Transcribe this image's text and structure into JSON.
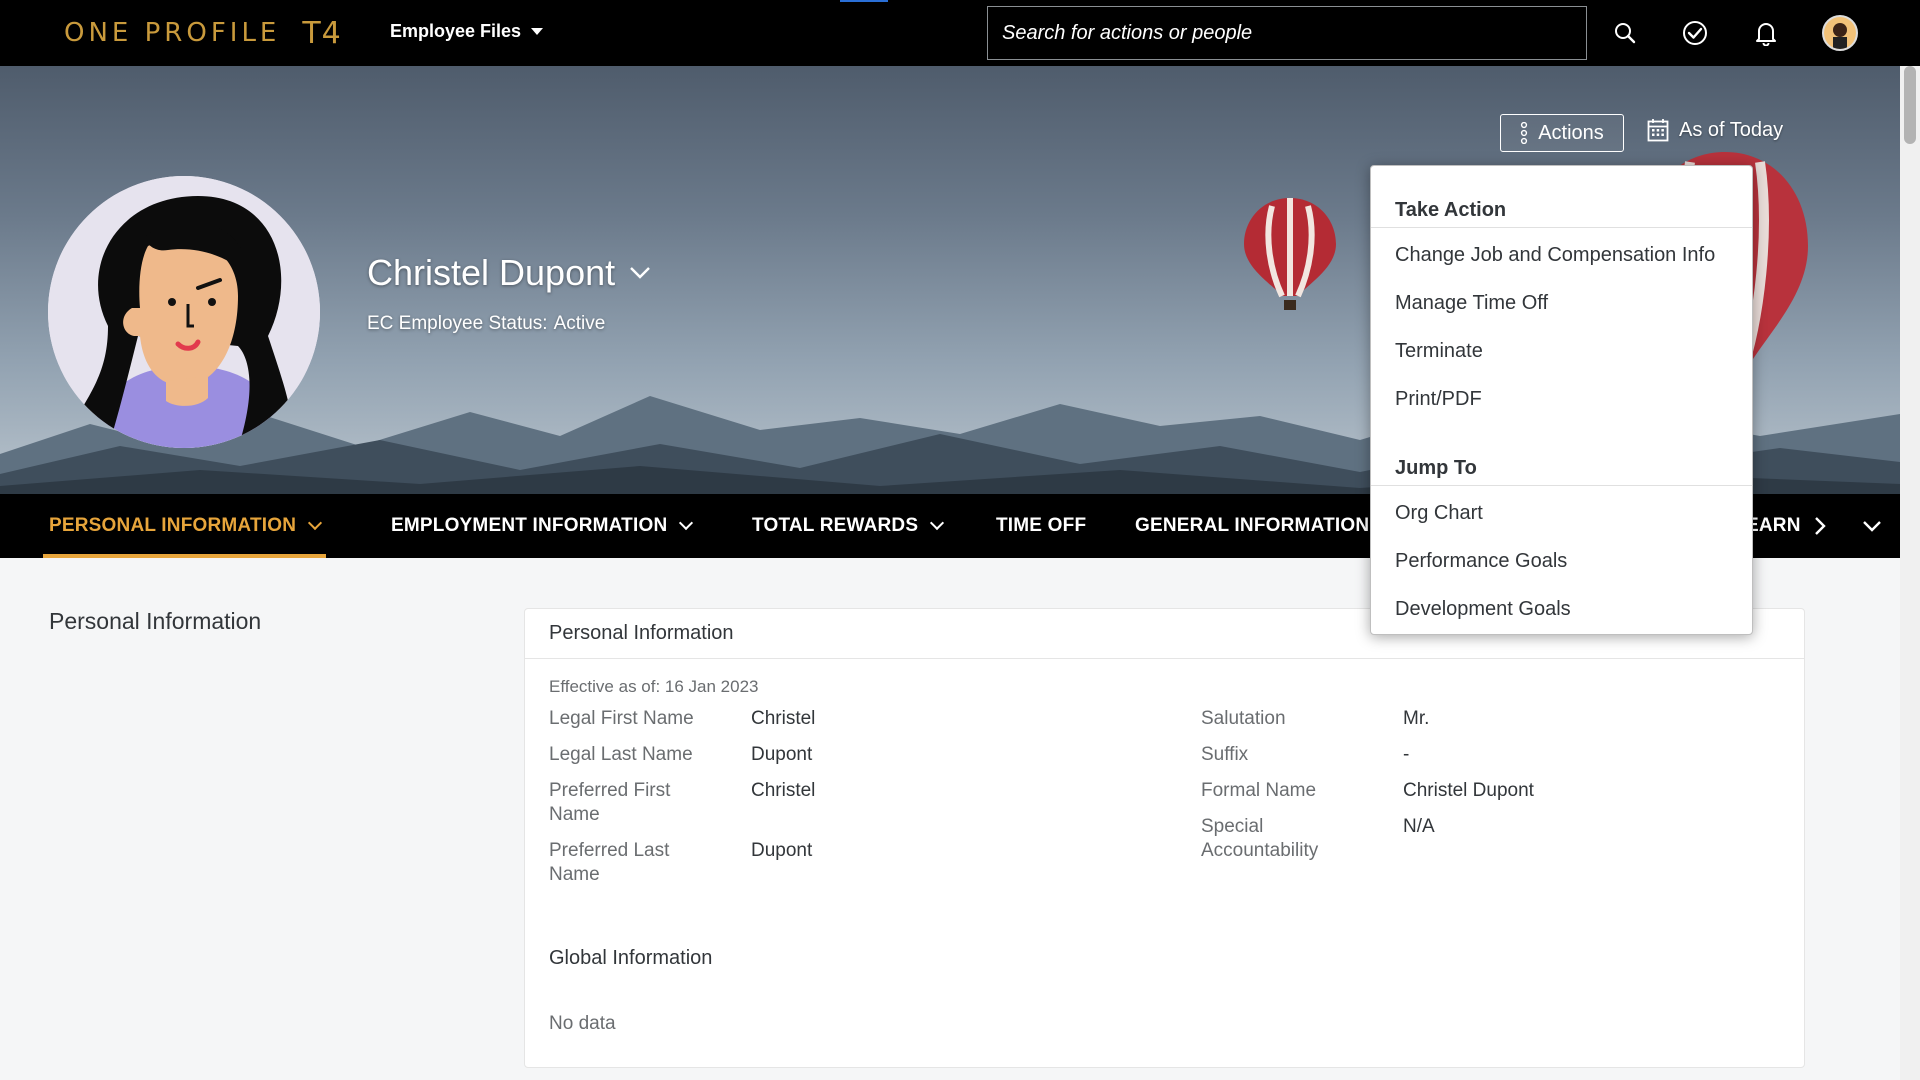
{
  "shell": {
    "logo_text": "ONE PROFILE",
    "logo_suffix": "T4",
    "module_label": "Employee Files",
    "search_placeholder": "Search for actions or people",
    "icons": [
      "search-icon",
      "task-check-icon",
      "bell-icon",
      "user-avatar"
    ]
  },
  "header": {
    "name": "Christel Dupont",
    "status_label": "EC Employee Status:",
    "status_value": "Active",
    "actions_label": "Actions",
    "as_of_label": "As of Today"
  },
  "tabs": [
    {
      "label": "PERSONAL INFORMATION",
      "active": true,
      "has_menu": true
    },
    {
      "label": "EMPLOYMENT INFORMATION",
      "active": false,
      "has_menu": true
    },
    {
      "label": "TOTAL REWARDS",
      "active": false,
      "has_menu": true
    },
    {
      "label": "TIME OFF",
      "active": false,
      "has_menu": false
    },
    {
      "label": "GENERAL INFORMATION",
      "active": false,
      "has_menu": false
    },
    {
      "label": "EARN",
      "active": false,
      "has_menu": false
    }
  ],
  "actions_menu": {
    "groups": [
      {
        "title": "Take Action",
        "items": [
          "Change Job and Compensation Info",
          "Manage Time Off",
          "Terminate",
          "Print/PDF"
        ]
      },
      {
        "title": "Jump To",
        "items": [
          "Org Chart",
          "Performance Goals",
          "Development Goals"
        ]
      }
    ]
  },
  "content": {
    "section_title": "Personal Information",
    "card_title": "Personal Information",
    "effective": "Effective as of: 16 Jan 2023",
    "left_fields": [
      {
        "label": "Legal First Name",
        "value": "Christel"
      },
      {
        "label": "Legal Last Name",
        "value": "Dupont"
      },
      {
        "label": "Preferred First Name",
        "value": "Christel"
      },
      {
        "label": "Preferred Last Name",
        "value": "Dupont"
      }
    ],
    "right_fields": [
      {
        "label": "Salutation",
        "value": "Mr."
      },
      {
        "label": "Suffix",
        "value": "-"
      },
      {
        "label": "Formal Name",
        "value": "Christel Dupont"
      },
      {
        "label": "Special Accountability",
        "value": "N/A"
      }
    ],
    "global_title": "Global Information",
    "no_data": "No data"
  },
  "colors": {
    "accent": "#e7a53b",
    "shell_bg": "#000000",
    "logo": "#c99a3c"
  }
}
